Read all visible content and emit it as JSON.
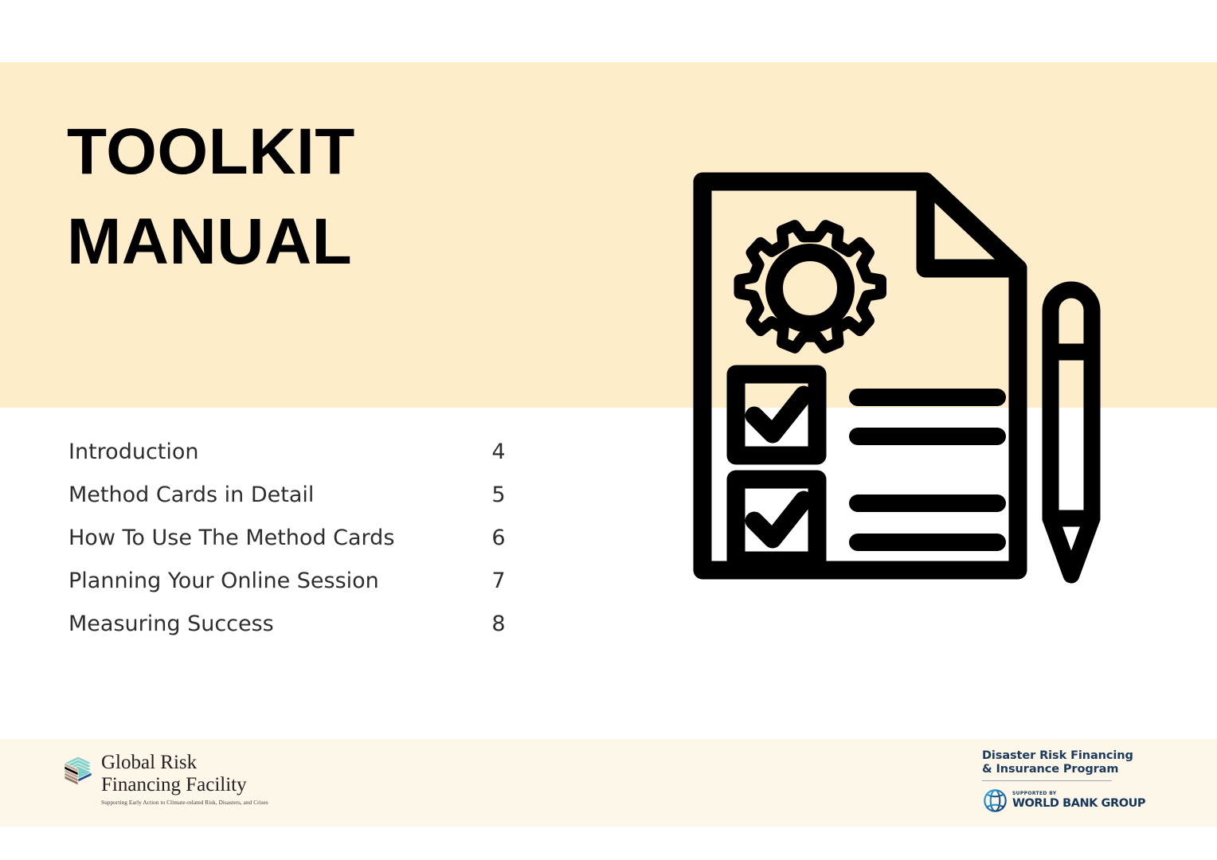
{
  "page": {
    "hero_bg_color": "#FDEDCB",
    "footer_bg_color": "#FDF7EA",
    "page_bg_color": "#FFFFFF",
    "ink_color": "#000000"
  },
  "title": {
    "line1": "TOOLKIT",
    "line2": "MANUAL"
  },
  "contents": [
    {
      "label": "Introduction",
      "page": "4"
    },
    {
      "label": "Method Cards in Detail",
      "page": "5"
    },
    {
      "label": "How To Use The Method Cards",
      "page": "6"
    },
    {
      "label": "Planning Your Online Session",
      "page": "7"
    },
    {
      "label": "Measuring Success",
      "page": "8"
    }
  ],
  "illustration": {
    "name": "document-with-gear-and-checklist-and-pencil",
    "elements": [
      "gear-icon",
      "folded-page-corner",
      "checkbox-checked",
      "checkbox-checked",
      "text-line",
      "text-line",
      "text-line",
      "text-line",
      "pencil-icon"
    ]
  },
  "footer": {
    "grif": {
      "name_line1": "Global Risk",
      "name_line2": "Financing Facility",
      "tagline": "Supporting Early Action to Climate-related Risk, Disasters, and Crises",
      "cube_colors": {
        "top": "#7FCFC4",
        "left": "#C3A88E",
        "accent": "#2B4B8F"
      }
    },
    "worldbank": {
      "program_line1": "Disaster Risk Financing",
      "program_line2": "& Insurance Program",
      "supported_by": "SUPPORTED BY",
      "organization": "WORLD BANK GROUP",
      "brand_color": "#16365C"
    }
  }
}
